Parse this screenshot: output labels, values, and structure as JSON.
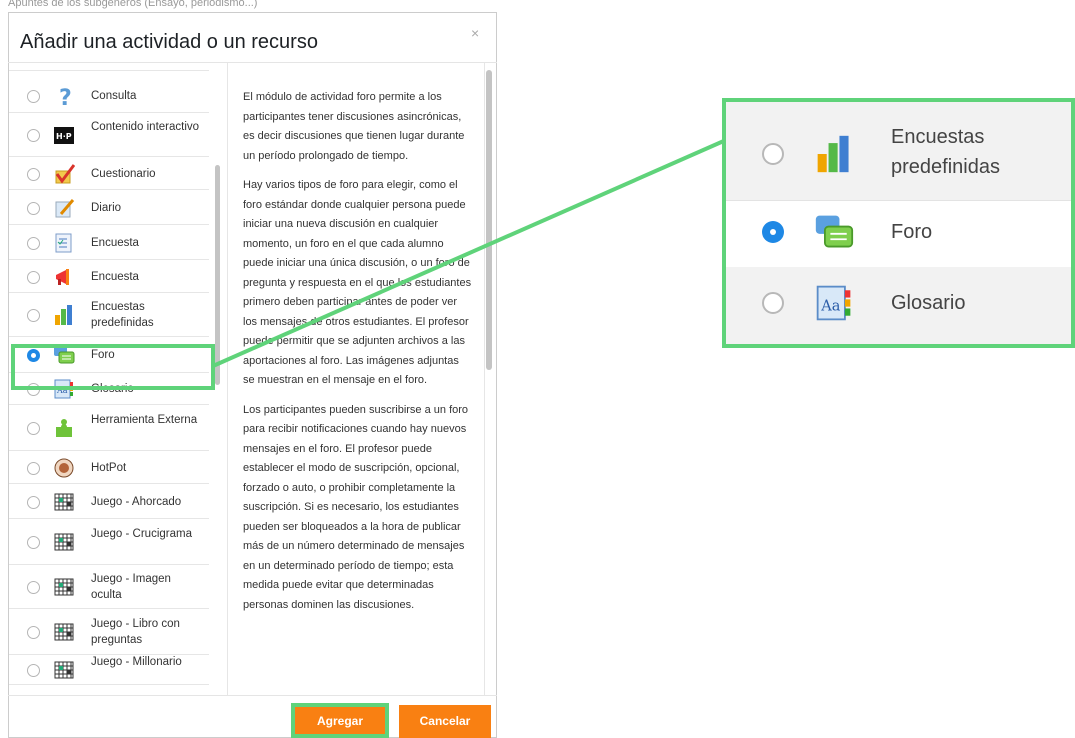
{
  "modal": {
    "top_strip": "Apuntes de los subgéneros (Ensayo, periodismo...)",
    "title": "Añadir una actividad o un recurso",
    "close_label": "×",
    "list_items": [
      {
        "label": "Consulta",
        "icon": "question-icon",
        "selected": false
      },
      {
        "label": "Contenido interactivo",
        "icon": "h5p-icon",
        "selected": false
      },
      {
        "label": "Cuestionario",
        "icon": "quiz-check-icon",
        "selected": false
      },
      {
        "label": "Diario",
        "icon": "journal-icon",
        "selected": false
      },
      {
        "label": "Encuesta",
        "icon": "survey-icon",
        "selected": false
      },
      {
        "label": "Encuesta",
        "icon": "feedback-megaphone-icon",
        "selected": false
      },
      {
        "label": "Encuestas predefinidas",
        "icon": "bar-chart-icon",
        "selected": false
      },
      {
        "label": "Foro",
        "icon": "forum-speech-icon",
        "selected": true
      },
      {
        "label": "Glosario",
        "icon": "glossary-icon",
        "selected": false
      },
      {
        "label": "Herramienta Externa",
        "icon": "puzzle-icon",
        "selected": false
      },
      {
        "label": "HotPot",
        "icon": "hotpot-icon",
        "selected": false
      },
      {
        "label": "Juego - Ahorcado",
        "icon": "game-grid-icon",
        "selected": false
      },
      {
        "label": "Juego - Crucigrama",
        "icon": "game-grid-icon",
        "selected": false
      },
      {
        "label": "Juego - Imagen oculta",
        "icon": "game-grid-icon",
        "selected": false
      },
      {
        "label": "Juego - Libro con preguntas",
        "icon": "game-grid-icon",
        "selected": false
      },
      {
        "label": "Juego - Millonario",
        "icon": "game-grid-icon",
        "selected": false
      }
    ],
    "description": [
      "El módulo de actividad foro permite a los participantes tener discusiones asincrónicas, es decir discusiones que tienen lugar durante un período prolongado de tiempo.",
      "Hay varios tipos de foro para elegir, como el foro estándar donde cualquier persona puede iniciar una nueva discusión en cualquier momento, un foro en el que cada alumno puede iniciar una única discusión, o un foro de pregunta y respuesta en el que los estudiantes primero deben participar antes de poder ver los mensajes de otros estudiantes. El profesor puede permitir que se adjunten archivos a las aportaciones al foro. Las imágenes adjuntas se muestran en el mensaje en el foro.",
      "Los participantes pueden suscribirse a un foro para recibir notificaciones cuando hay nuevos mensajes en el foro. El profesor puede establecer el modo de suscripción, opcional, forzado o auto, o prohibir completamente la suscripción. Si es necesario, los estudiantes pueden ser bloqueados a la hora de publicar más de un número determinado de mensajes en un determinado período de tiempo; esta medida puede evitar que determinadas personas dominen las discusiones."
    ],
    "add_label": "Agregar",
    "cancel_label": "Cancelar"
  },
  "zoom": {
    "items": [
      {
        "label": "Encuestas predefinidas",
        "icon": "bar-chart-icon",
        "selected": false
      },
      {
        "label": "Foro",
        "icon": "forum-speech-icon",
        "selected": true
      },
      {
        "label": "Glosario",
        "icon": "glossary-icon",
        "selected": false
      }
    ]
  },
  "colors": {
    "highlight": "#5fd37a",
    "button": "#f98012",
    "radio_selected": "#1e88e5"
  }
}
